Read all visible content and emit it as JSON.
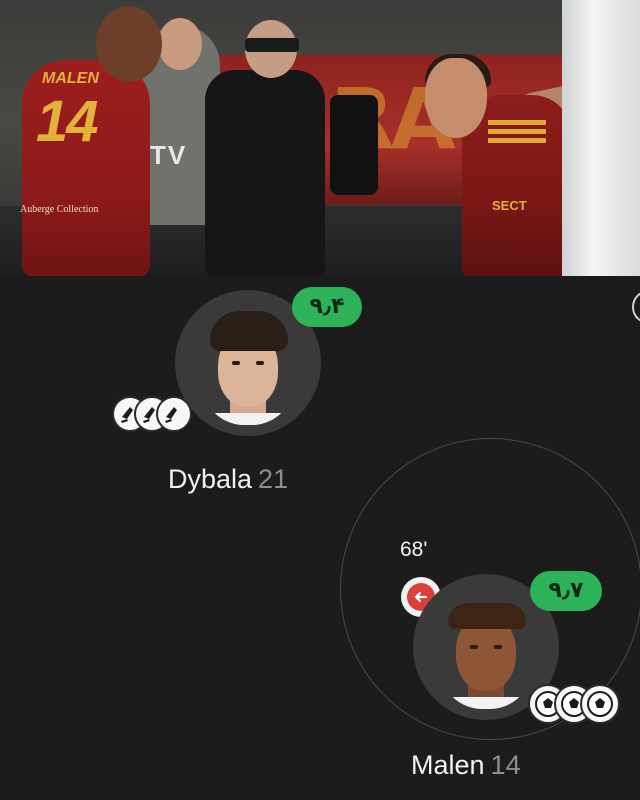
{
  "hero": {
    "jersey_name": "MALEN",
    "jersey_number": "14",
    "jersey_sponsor": "Auberge Collection",
    "background_sign": "TV",
    "banner_letters": "RA",
    "right_sponsor": "SECT"
  },
  "lineup": {
    "players": [
      {
        "name": "Dybala",
        "number": "21",
        "rating": "۹٫۴",
        "rating_color": "#2fb35a",
        "event_icons": [
          "boot-icon",
          "boot-icon",
          "boot-icon"
        ]
      },
      {
        "name": "Malen",
        "number": "14",
        "rating": "۹٫۷",
        "rating_color": "#2fb35a",
        "sub_minute": "68'",
        "sub_icon": "substitution-out-arrow-icon",
        "sub_icon_color": "#d9403c",
        "event_icons": [
          "soccer-ball-icon",
          "soccer-ball-icon",
          "soccer-ball-icon"
        ]
      }
    ]
  }
}
